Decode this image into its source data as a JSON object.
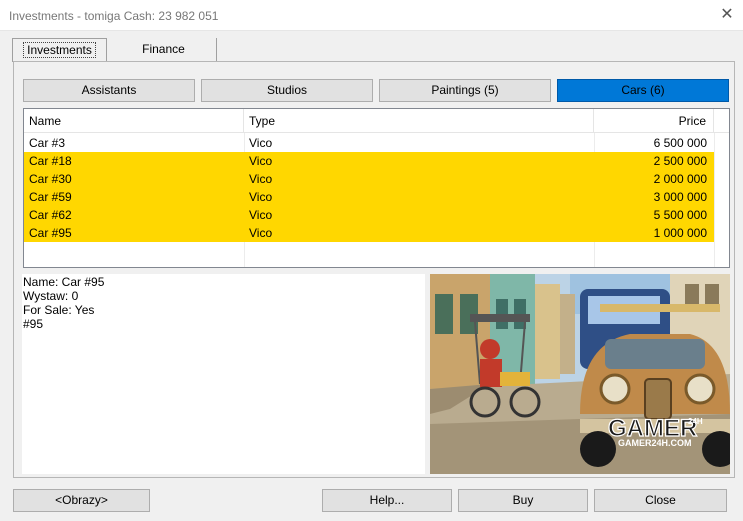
{
  "window": {
    "title": "Investments - tomiga Cash: 23 982 051",
    "close_glyph": "✕"
  },
  "tabs": [
    {
      "label": "Investments",
      "active": true
    },
    {
      "label": "Finance",
      "active": false
    }
  ],
  "categories": [
    {
      "label": "Assistants",
      "selected": false
    },
    {
      "label": "Studios",
      "selected": false
    },
    {
      "label": "Paintings (5)",
      "selected": false
    },
    {
      "label": "Cars (6)",
      "selected": true
    }
  ],
  "list": {
    "columns": [
      "Name",
      "Type",
      "Price"
    ],
    "rows": [
      {
        "name": "Car #3",
        "type": "Vico",
        "price": "6 500 000",
        "highlight": false
      },
      {
        "name": "Car #18",
        "type": "Vico",
        "price": "2 500 000",
        "highlight": true
      },
      {
        "name": "Car #30",
        "type": "Vico",
        "price": "2 000 000",
        "highlight": true
      },
      {
        "name": "Car #59",
        "type": "Vico",
        "price": "3 000 000",
        "highlight": true
      },
      {
        "name": "Car #62",
        "type": "Vico",
        "price": "5 500 000",
        "highlight": true
      },
      {
        "name": "Car #95",
        "type": "Vico",
        "price": "1 000 000",
        "highlight": true
      }
    ],
    "highlight_color": "#ffd700"
  },
  "details": {
    "lines": [
      "Name: Car #95",
      "Wystaw: 0",
      "For Sale: Yes",
      "#95"
    ]
  },
  "photo": {
    "watermark_main": "GAMER",
    "watermark_sub": "GAMER24H.COM",
    "watermark_tag": "24H"
  },
  "buttons": {
    "obrazy": "<Obrazy>",
    "help": "Help...",
    "buy": "Buy",
    "close": "Close"
  },
  "colors": {
    "selected_button": "#0078d7",
    "highlight_row": "#ffd700"
  }
}
